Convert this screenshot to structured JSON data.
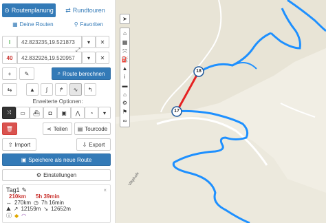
{
  "tabs": {
    "route_planning": "Routenplanung",
    "round_tours": "Rundtouren"
  },
  "links": {
    "your_routes": "Deine Routen",
    "favorites": "Favoriten"
  },
  "waypoints": [
    {
      "marker": "I",
      "value": "42.823235,19.521873"
    },
    {
      "marker": "40",
      "value": "42.832926,19.520957"
    }
  ],
  "buttons": {
    "calculate_route": "Route berechnen",
    "share": "Teilen",
    "tourcode": "Tourcode",
    "import": "Import",
    "export": "Export",
    "save_new_route": "Speichere als neue Route",
    "settings": "Einstellungen"
  },
  "extended_options_label": "Erweiterte Optionen:",
  "day_card": {
    "title": "Tag1",
    "distance_red": "210km",
    "time_red": "5h 39min",
    "distance": "270km",
    "time": "7h 16min",
    "ascent": "12159m",
    "descent": "12652m"
  },
  "map": {
    "road_label": "Vikpholk",
    "markers": [
      {
        "label": "18"
      },
      {
        "label": "17"
      }
    ],
    "route_color": "#1e90ff",
    "segment_color": "#e52222"
  },
  "colors": {
    "primary": "#337ab7",
    "danger": "#d9534f"
  }
}
